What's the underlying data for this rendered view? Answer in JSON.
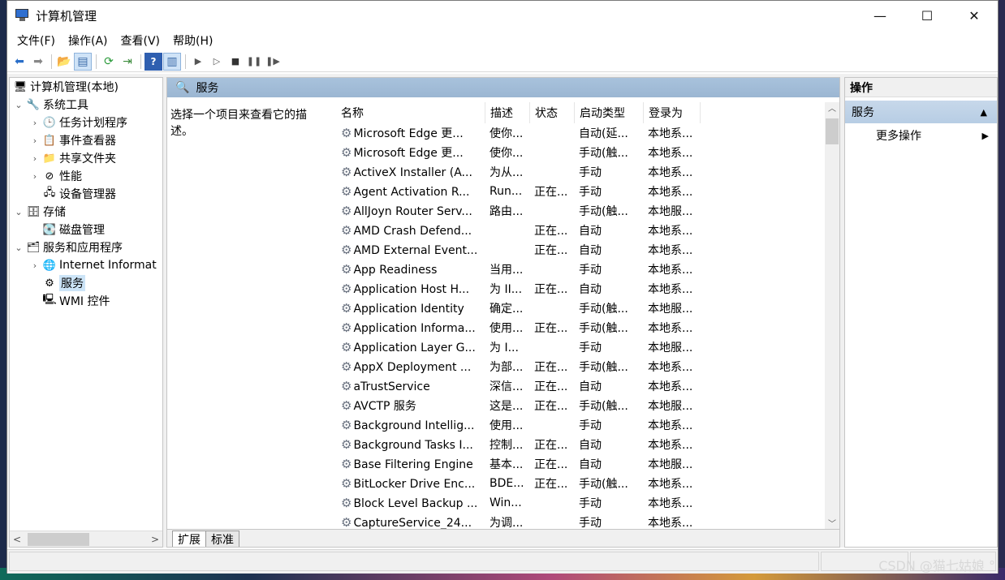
{
  "window": {
    "title": "计算机管理",
    "controls": {
      "minimize": "—",
      "maximize": "☐",
      "close": "✕"
    }
  },
  "menu": [
    "文件(F)",
    "操作(A)",
    "查看(V)",
    "帮助(H)"
  ],
  "tree": [
    {
      "label": "计算机管理(本地)",
      "level": 0,
      "expander": "",
      "icon": "computer-management-icon",
      "glyph": "🖥"
    },
    {
      "label": "系统工具",
      "level": 1,
      "expander": "⌄",
      "icon": "system-tools-icon",
      "glyph": "🔧"
    },
    {
      "label": "任务计划程序",
      "level": 2,
      "expander": "›",
      "icon": "task-scheduler-icon",
      "glyph": "🕒"
    },
    {
      "label": "事件查看器",
      "level": 2,
      "expander": "›",
      "icon": "event-viewer-icon",
      "glyph": "📋"
    },
    {
      "label": "共享文件夹",
      "level": 2,
      "expander": "›",
      "icon": "shared-folders-icon",
      "glyph": "📁"
    },
    {
      "label": "性能",
      "level": 2,
      "expander": "›",
      "icon": "performance-icon",
      "glyph": "⊘"
    },
    {
      "label": "设备管理器",
      "level": 2,
      "expander": "",
      "icon": "device-manager-icon",
      "glyph": "🖧"
    },
    {
      "label": "存储",
      "level": 1,
      "expander": "⌄",
      "icon": "storage-icon",
      "glyph": "🗄"
    },
    {
      "label": "磁盘管理",
      "level": 2,
      "expander": "",
      "icon": "disk-management-icon",
      "glyph": "💽"
    },
    {
      "label": "服务和应用程序",
      "level": 1,
      "expander": "⌄",
      "icon": "services-apps-icon",
      "glyph": "🗂"
    },
    {
      "label": "Internet Informat",
      "level": 2,
      "expander": "›",
      "icon": "iis-icon",
      "glyph": "🌐"
    },
    {
      "label": "服务",
      "level": 2,
      "expander": "",
      "icon": "services-icon",
      "glyph": "⚙",
      "selected": true
    },
    {
      "label": "WMI 控件",
      "level": 2,
      "expander": "",
      "icon": "wmi-control-icon",
      "glyph": "🖳"
    }
  ],
  "center": {
    "header": "服务",
    "description": "选择一个项目来查看它的描述。",
    "columns": [
      "名称",
      "描述",
      "状态",
      "启动类型",
      "登录为"
    ],
    "rows": [
      [
        "Microsoft Edge 更...",
        "使你...",
        "",
        "自动(延...",
        "本地系..."
      ],
      [
        "Microsoft Edge 更...",
        "使你...",
        "",
        "手动(触...",
        "本地系..."
      ],
      [
        "ActiveX Installer (A...",
        "为从...",
        "",
        "手动",
        "本地系..."
      ],
      [
        "Agent Activation R...",
        "Run...",
        "正在...",
        "手动",
        "本地系..."
      ],
      [
        "AllJoyn Router Serv...",
        "路由...",
        "",
        "手动(触...",
        "本地服..."
      ],
      [
        "AMD Crash Defend...",
        "",
        "正在...",
        "自动",
        "本地系..."
      ],
      [
        "AMD External Event...",
        "",
        "正在...",
        "自动",
        "本地系..."
      ],
      [
        "App Readiness",
        "当用...",
        "",
        "手动",
        "本地系..."
      ],
      [
        "Application Host H...",
        "为 II...",
        "正在...",
        "自动",
        "本地系..."
      ],
      [
        "Application Identity",
        "确定...",
        "",
        "手动(触...",
        "本地服..."
      ],
      [
        "Application Informa...",
        "使用...",
        "正在...",
        "手动(触...",
        "本地系..."
      ],
      [
        "Application Layer G...",
        "为 I...",
        "",
        "手动",
        "本地服..."
      ],
      [
        "AppX Deployment ...",
        "为部...",
        "正在...",
        "手动(触...",
        "本地系..."
      ],
      [
        "aTrustService",
        "深信...",
        "正在...",
        "自动",
        "本地系..."
      ],
      [
        "AVCTP 服务",
        "这是...",
        "正在...",
        "手动(触...",
        "本地服..."
      ],
      [
        "Background Intellig...",
        "使用...",
        "",
        "手动",
        "本地系..."
      ],
      [
        "Background Tasks I...",
        "控制...",
        "正在...",
        "自动",
        "本地系..."
      ],
      [
        "Base Filtering Engine",
        "基本...",
        "正在...",
        "自动",
        "本地服..."
      ],
      [
        "BitLocker Drive Enc...",
        "BDE...",
        "正在...",
        "手动(触...",
        "本地系..."
      ],
      [
        "Block Level Backup ...",
        "Win...",
        "",
        "手动",
        "本地系..."
      ],
      [
        "CaptureService_24...",
        "为调...",
        "",
        "手动",
        "本地系..."
      ]
    ],
    "tabs": [
      "扩展",
      "标准"
    ]
  },
  "actions": {
    "title": "操作",
    "group": "服务",
    "items": [
      "更多操作"
    ]
  },
  "watermark": "CSDN @猫七姑娘 °"
}
